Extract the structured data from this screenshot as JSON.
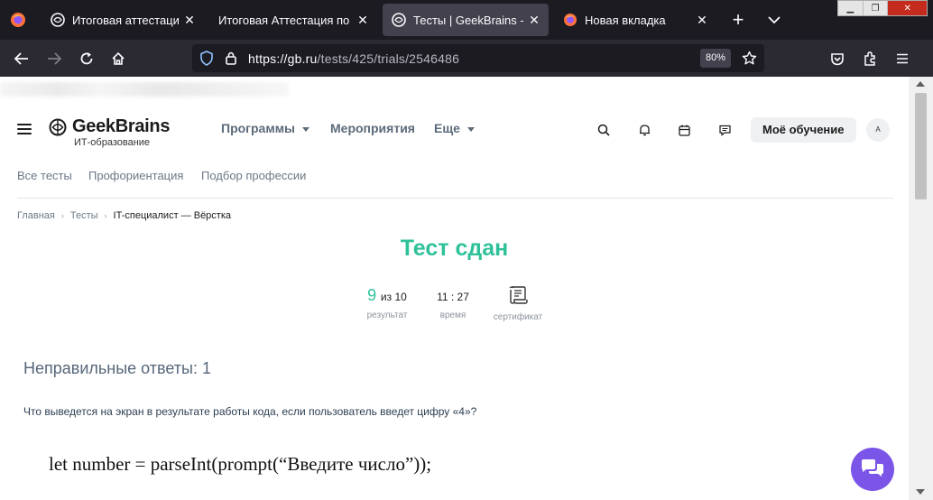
{
  "browser": {
    "tabs": [
      {
        "title": "Итоговая аттестация | И",
        "favicon": "geekbrains-icon",
        "active": false
      },
      {
        "title": "Итоговая Аттестация по пре",
        "favicon": "geekbrains-icon",
        "active": false
      },
      {
        "title": "Тесты | GeekBrains - обр",
        "favicon": "geekbrains-icon",
        "active": true
      },
      {
        "title": "Новая вкладка",
        "favicon": "firefox-icon",
        "active": false
      }
    ],
    "new_tab_label": "+",
    "url_host": "https://gb.ru",
    "url_path": "/tests/425/trials/2546486",
    "zoom": "80%"
  },
  "site": {
    "logo_name": "GeekBrains",
    "logo_subtitle": "ИТ-образование",
    "menu": [
      {
        "label": "Программы",
        "dropdown": true
      },
      {
        "label": "Мероприятия",
        "dropdown": false
      },
      {
        "label": "Еще",
        "dropdown": true
      }
    ],
    "my_learning_label": "Моё обучение",
    "avatar_label": "А",
    "subnav": [
      "Все тесты",
      "Профориентация",
      "Подбор профессии"
    ],
    "breadcrumbs": [
      "Главная",
      "Тесты",
      "IT-специалист — Вёрстка"
    ]
  },
  "result": {
    "title": "Тест сдан",
    "score": "9",
    "score_of": "из 10",
    "score_label": "результат",
    "time": "11 : 27",
    "time_label": "время",
    "certificate_label": "сертификат"
  },
  "wrong_answers": {
    "heading": "Неправильные ответы: 1",
    "question": "Что выведется на экран в результате работы кода, если пользователь введет цифру «4»?",
    "code_line": "let number = parseInt(prompt(“Введите число”));"
  },
  "colors": {
    "accent_green": "#2fc29a",
    "chat_purple": "#7b55e8"
  }
}
